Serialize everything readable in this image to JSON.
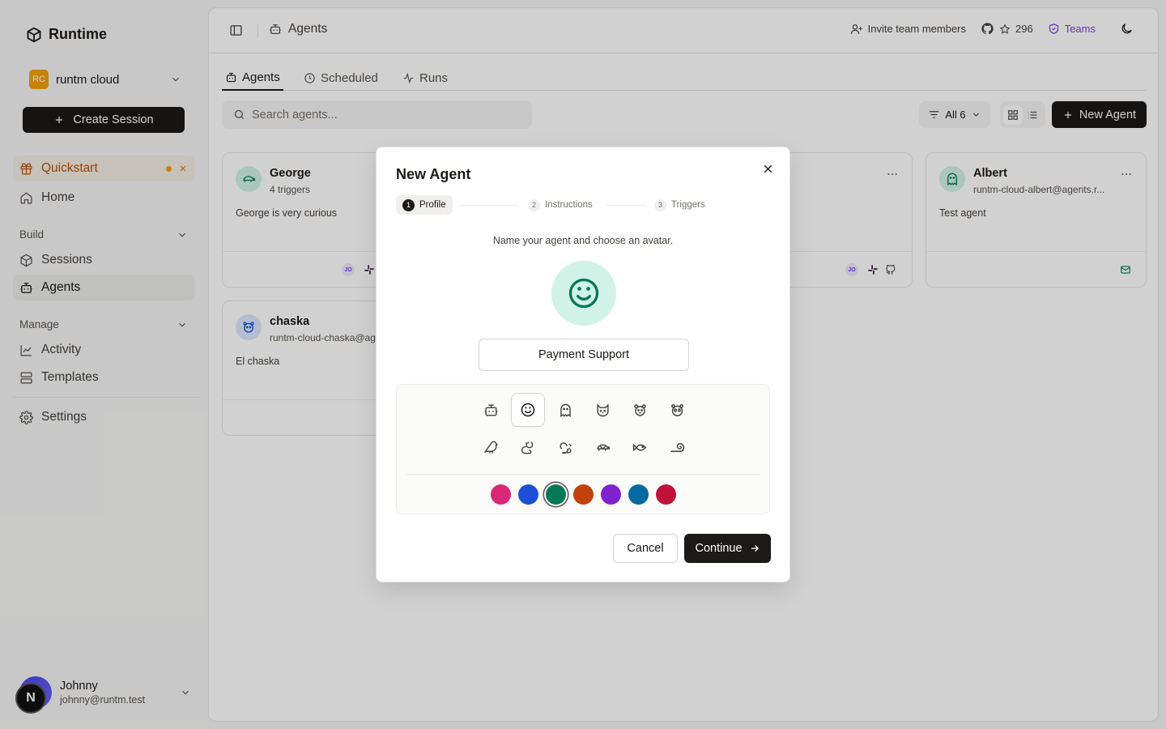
{
  "brand": {
    "name": "Runtime"
  },
  "org": {
    "badge": "RC",
    "name": "runtm cloud"
  },
  "sidebar": {
    "create_session": "Create Session",
    "quickstart": "Quickstart",
    "home": "Home",
    "build_section": "Build",
    "sessions": "Sessions",
    "agents": "Agents",
    "manage_section": "Manage",
    "activity": "Activity",
    "templates": "Templates",
    "settings": "Settings"
  },
  "user": {
    "name": "Johnny",
    "email": "johnny@runtm.test",
    "badge": "N"
  },
  "topbar": {
    "breadcrumb": "Agents",
    "invite": "Invite team members",
    "stars": "296",
    "teams": "Teams"
  },
  "tabs": [
    {
      "label": "Agents"
    },
    {
      "label": "Scheduled"
    },
    {
      "label": "Runs"
    }
  ],
  "toolbar": {
    "search_placeholder": "Search agents...",
    "filter": "All 6",
    "new_agent": "New Agent"
  },
  "cards": [
    {
      "name": "George",
      "subtitle": "4 triggers",
      "description": "George is very curious"
    },
    {
      "name": "Albert",
      "subtitle": "runtm-cloud-albert@agents.r...",
      "description": "Test agent"
    },
    {
      "name": "chaska",
      "subtitle": "runtm-cloud-chaska@age",
      "description": "El chaska"
    }
  ],
  "chips": {
    "jo": "JO"
  },
  "modal": {
    "title": "New Agent",
    "steps": [
      {
        "num": "1",
        "label": "Profile"
      },
      {
        "num": "2",
        "label": "Instructions"
      },
      {
        "num": "3",
        "label": "Triggers"
      }
    ],
    "prompt": "Name your agent and choose an avatar.",
    "name_value": "Payment Support",
    "icons": [
      "bot-icon",
      "smile-icon",
      "ghost-icon",
      "cat-icon",
      "bear-icon",
      "panda-icon",
      "bird-icon",
      "rabbit-icon",
      "squirrel-icon",
      "turtle-icon",
      "fish-icon",
      "snail-icon"
    ],
    "selected_icon": "smile-icon",
    "colors": [
      "#db2777",
      "#1d4ed8",
      "#047857",
      "#c2410c",
      "#7e22ce",
      "#0369a1",
      "#be123c"
    ],
    "selected_color": "#047857",
    "cancel": "Cancel",
    "continue": "Continue"
  }
}
